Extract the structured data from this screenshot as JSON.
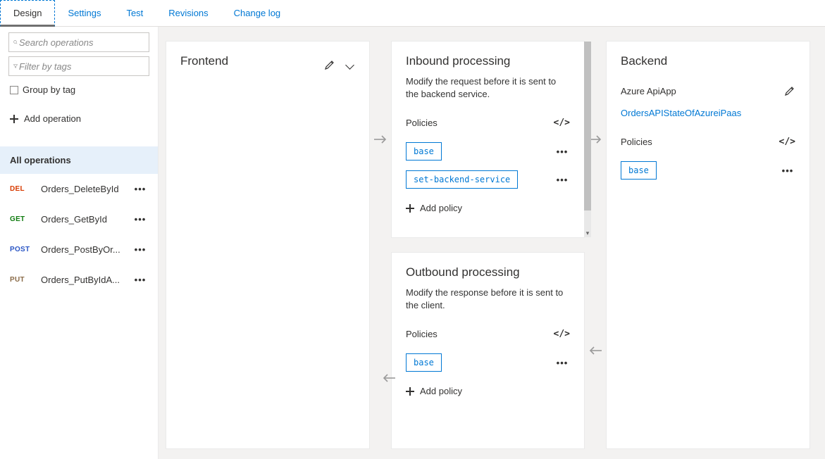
{
  "tabs": [
    "Design",
    "Settings",
    "Test",
    "Revisions",
    "Change log"
  ],
  "sidebar": {
    "search_placeholder": "Search operations",
    "filter_placeholder": "Filter by tags",
    "group_label": "Group by tag",
    "add_operation": "Add operation",
    "all_operations": "All operations",
    "operations": [
      {
        "method": "DEL",
        "cls": "m-del",
        "name": "Orders_DeleteById"
      },
      {
        "method": "GET",
        "cls": "m-get",
        "name": "Orders_GetById"
      },
      {
        "method": "POST",
        "cls": "m-post",
        "name": "Orders_PostByOr..."
      },
      {
        "method": "PUT",
        "cls": "m-put",
        "name": "Orders_PutByIdA..."
      }
    ]
  },
  "frontend": {
    "title": "Frontend"
  },
  "inbound": {
    "title": "Inbound processing",
    "desc": "Modify the request before it is sent to the backend service.",
    "policies_label": "Policies",
    "policies": [
      "base",
      "set-backend-service"
    ],
    "add_policy": "Add policy"
  },
  "outbound": {
    "title": "Outbound processing",
    "desc": "Modify the response before it is sent to the client.",
    "policies_label": "Policies",
    "policies": [
      "base"
    ],
    "add_policy": "Add policy"
  },
  "backend": {
    "title": "Backend",
    "subtitle": "Azure ApiApp",
    "link": "OrdersAPIStateOfAzureiPaas",
    "policies_label": "Policies",
    "policies": [
      "base"
    ]
  }
}
